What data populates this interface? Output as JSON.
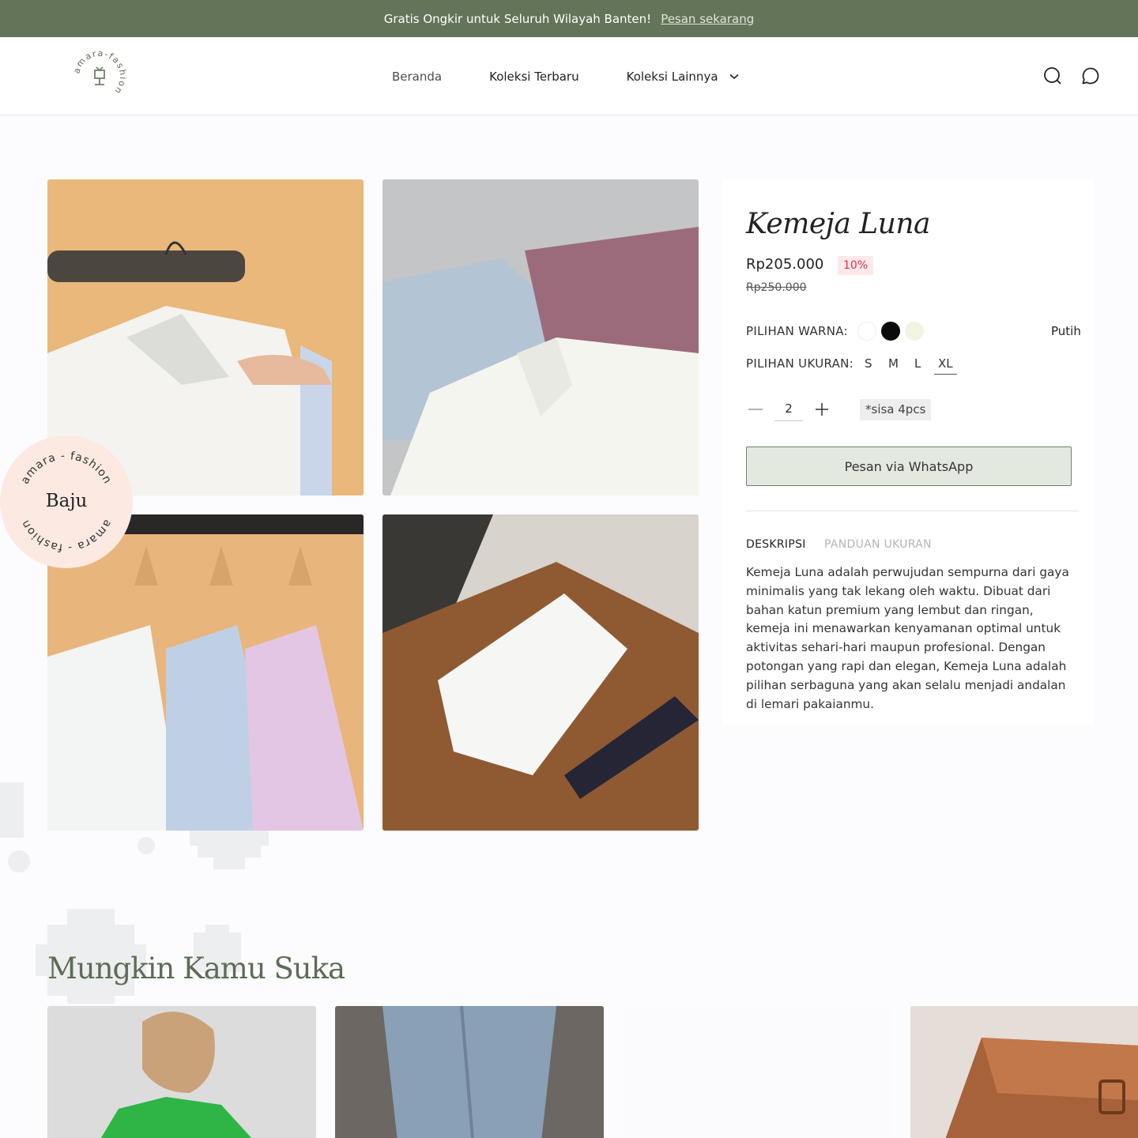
{
  "announcement": {
    "text": "Gratis Ongkir untuk Seluruh Wilayah Banten!",
    "link": "Pesan sekarang"
  },
  "brand": {
    "name": "amara-fashion"
  },
  "nav": [
    {
      "label": "Beranda"
    },
    {
      "label": "Koleksi Terbaru"
    },
    {
      "label": "Koleksi Lainnya"
    }
  ],
  "badge": {
    "ring_text": "amara - fashion",
    "title": "Baju"
  },
  "product": {
    "title": "Kemeja Luna",
    "price": "Rp205.000",
    "discount": "10%",
    "old_price": "Rp250.000",
    "color_label": "PILIHAN WARNA:",
    "colors": [
      {
        "name": "Putih",
        "hex": "#ffffff"
      },
      {
        "name": "Hitam",
        "hex": "#0a0a0a"
      },
      {
        "name": "Krem",
        "hex": "#f3f4e2"
      }
    ],
    "selected_color": "Putih",
    "size_label": "PILIHAN UKURAN:",
    "sizes": [
      "S",
      "M",
      "L",
      "XL"
    ],
    "selected_size": "XL",
    "quantity": "2",
    "stock": "*sisa 4pcs",
    "order_button": "Pesan via WhatsApp",
    "tabs": [
      "DESKRIPSI",
      "PANDUAN UKURAN"
    ],
    "description": "Kemeja Luna adalah perwujudan sempurna dari gaya minimalis yang tak lekang oleh waktu. Dibuat dari bahan katun premium yang lembut dan ringan, kemeja ini menawarkan kenyamanan optimal untuk aktivitas sehari-hari maupun profesional. Dengan potongan yang rapi dan elegan, Kemeja Luna adalah pilihan serbaguna yang akan selalu menjadi andalan di lemari pakaianmu."
  },
  "recommend": {
    "title": "Mungkin Kamu Suka"
  },
  "colors": {
    "primary": "#647459",
    "badge_bg": "#fce9e2",
    "button_bg": "#e4e9e0",
    "discount": "#d9344a"
  }
}
